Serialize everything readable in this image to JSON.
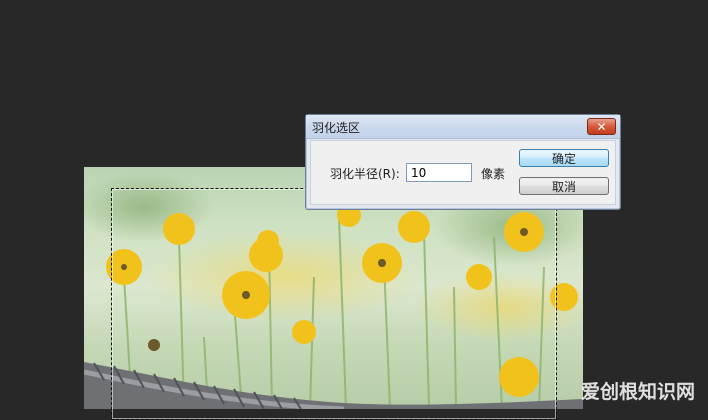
{
  "dialog": {
    "title": "羽化选区",
    "close_icon": "close-icon",
    "radius_label": "羽化半径(R):",
    "radius_value": "10",
    "unit_label": "像素",
    "ok_label": "确定",
    "cancel_label": "取消"
  },
  "watermark": "爱创根知识网",
  "colors": {
    "canvas_bg": "#282828",
    "ok_border": "#3c7fb1",
    "close_red": "#d65a3c"
  }
}
